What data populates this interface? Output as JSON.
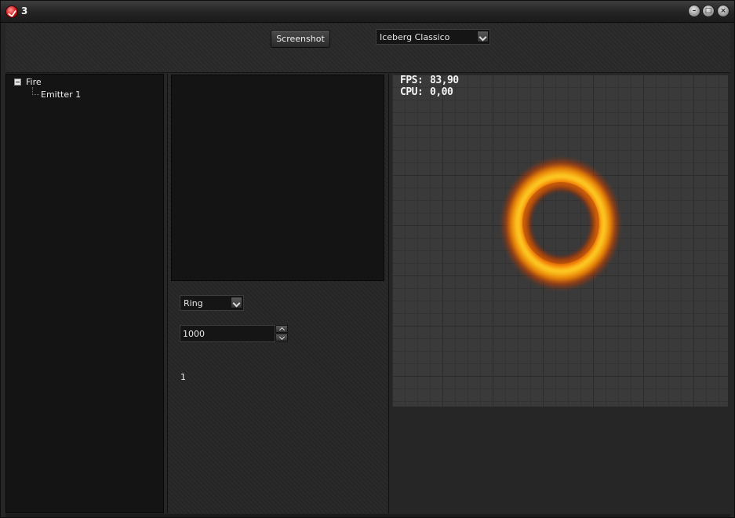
{
  "window": {
    "title": "3"
  },
  "toolbar": {
    "screenshot_label": "Screenshot",
    "theme_value": "Iceberg Classico"
  },
  "tree": {
    "root_label": "Fire",
    "child_label": "Emitter 1"
  },
  "emitter": {
    "shape_value": "Ring",
    "particle_count": "1000",
    "emitter_count": "1"
  },
  "viewport": {
    "fps_label": "FPS:",
    "fps_value": "83,90",
    "cpu_label": "CPU:",
    "cpu_value": "0,00"
  },
  "icons": {
    "app": "app-logo-icon",
    "minimize": "minimize-icon",
    "maximize": "maximize-icon",
    "close": "close-icon",
    "dropdown": "chevron-down-icon",
    "spin_up": "chevron-up-icon",
    "spin_down": "chevron-down-icon",
    "tree_collapse": "collapse-icon"
  },
  "colors": {
    "fire_inner": "#ffd728",
    "fire_outer": "#c83c00",
    "panel_bg": "#141414"
  }
}
